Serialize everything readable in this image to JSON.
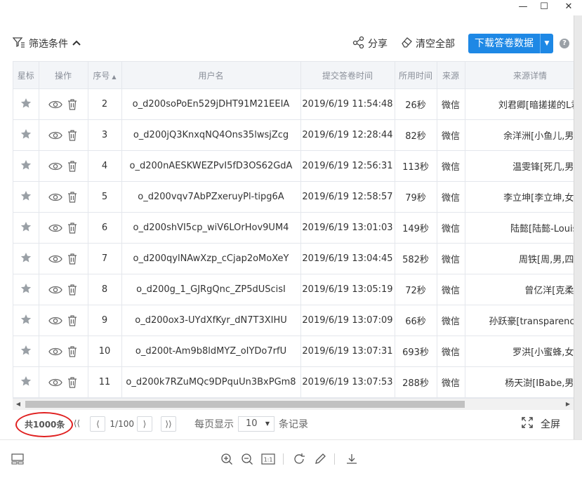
{
  "window": {
    "minimize": "—",
    "maximize": "☐",
    "close": "✕"
  },
  "toolbar": {
    "filter_label": "筛选条件",
    "share_label": "分享",
    "clear_label": "清空全部",
    "download_label": "下载答卷数据",
    "help": "?"
  },
  "table": {
    "headers": [
      "星标",
      "操作",
      "序号",
      "用户名",
      "提交答卷时间",
      "所用时间",
      "来源",
      "来源详情"
    ],
    "rows": [
      {
        "index": "2",
        "user": "o_d200soPoEn529jDHT91M21EEIA",
        "time": "2019/6/19 11:54:48",
        "duration": "26秒",
        "source": "微信",
        "detail": "刘君卿[暗搓搓的L君,女,"
      },
      {
        "index": "3",
        "user": "o_d200jQ3KnxqNQ4Ons35lwsjZcg",
        "time": "2019/6/19 12:28:44",
        "duration": "82秒",
        "source": "微信",
        "detail": "余洋洲[小鱼儿,男,四川"
      },
      {
        "index": "4",
        "user": "o_d200nAESKWEZPvI5fD3OS62GdA",
        "time": "2019/6/19 12:56:31",
        "duration": "113秒",
        "source": "微信",
        "detail": "温雯锋[死几,男,四川"
      },
      {
        "index": "5",
        "user": "o_d200vqv7AbPZxeruyPl-tipg6A",
        "time": "2019/6/19 12:58:57",
        "duration": "79秒",
        "source": "微信",
        "detail": "李立坤[李立坤,女,内蒙"
      },
      {
        "index": "6",
        "user": "o_d200shVI5cp_wiV6LOrHov9UM4",
        "time": "2019/6/19 13:01:03",
        "duration": "149秒",
        "source": "微信",
        "detail": "陆懿[陆懿-Louise,未"
      },
      {
        "index": "7",
        "user": "o_d200qylNAwXzp_cCjap2oMoXeY",
        "time": "2019/6/19 13:04:45",
        "duration": "582秒",
        "source": "微信",
        "detail": "周铁[周,男,四川,成"
      },
      {
        "index": "8",
        "user": "o_d200g_1_GJRgQnc_ZP5dUScisI",
        "time": "2019/6/19 13:05:19",
        "duration": "72秒",
        "source": "微信",
        "detail": "曾亿洋[克柔,未知"
      },
      {
        "index": "9",
        "user": "o_d200ox3-UYdXfKyr_dN7T3XIHU",
        "time": "2019/6/19 13:07:09",
        "duration": "66秒",
        "source": "微信",
        "detail": "孙跃豪[transparency,男,"
      },
      {
        "index": "10",
        "user": "o_d200t-Am9b8ldMYZ_oIYDo7rfU",
        "time": "2019/6/19 13:07:31",
        "duration": "693秒",
        "source": "微信",
        "detail": "罗洪[小蜜蜂,女,堪培"
      },
      {
        "index": "11",
        "user": "o_d200k7RZuMQc9DPquUn3BxPGm8",
        "time": "2019/6/19 13:07:53",
        "duration": "288秒",
        "source": "微信",
        "detail": "杨天澍[IBabe,男,陕西"
      }
    ]
  },
  "pagination": {
    "total": "共1000条",
    "first": "⟨⟨",
    "prev": "⟨",
    "page": "1/100",
    "next": "⟩",
    "last": "⟩⟩",
    "per_page_label": "每页显示",
    "per_page_value": "10",
    "records_label": "条记录",
    "fullscreen_label": "全屏"
  },
  "icons": [
    "filter-icon",
    "chevron-up-icon",
    "share-icon",
    "eraser-icon",
    "star-icon",
    "eye-icon",
    "trash-icon",
    "expand-icon",
    "layout-icon",
    "zoom-in-icon",
    "zoom-out-icon",
    "actual-size-icon",
    "rotate-icon",
    "edit-icon",
    "download-icon"
  ],
  "colors": {
    "accent": "#1e88e5",
    "highlight": "#e02020",
    "header_bg": "#f3f5f8",
    "star": "#9aa0a6"
  },
  "viewer": {
    "actual_size_label": "1:1"
  }
}
